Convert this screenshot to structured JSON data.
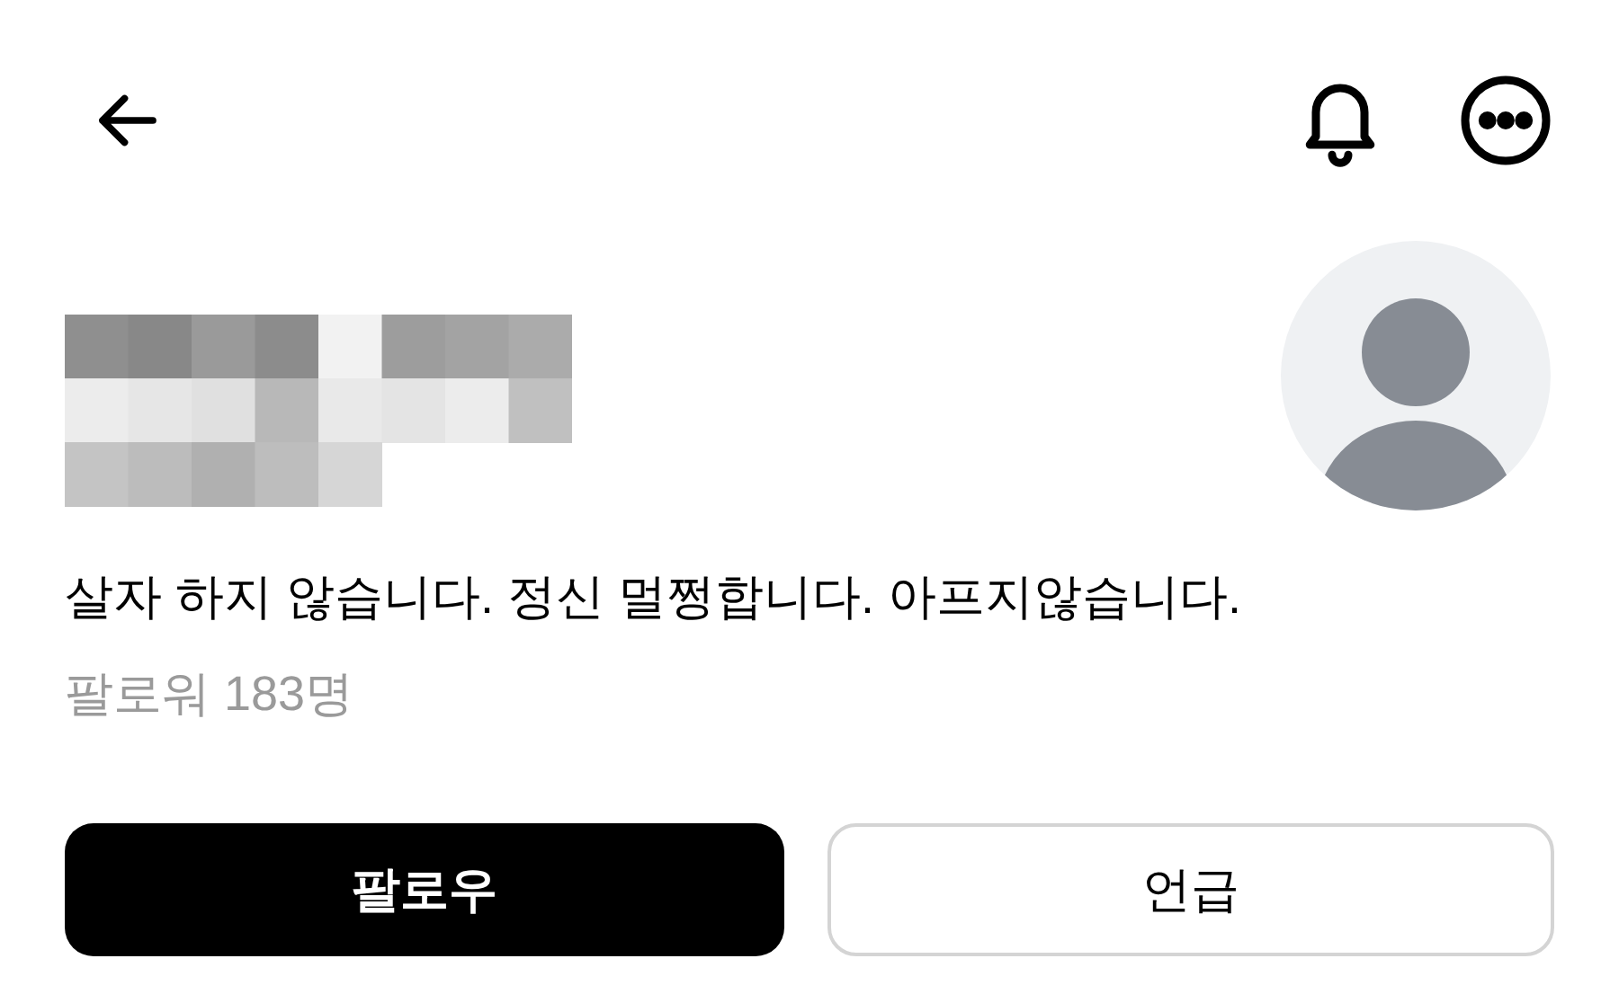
{
  "bio": "살자 하지 않습니다. 정신 멀쩡합니다. 아프지않습니다.",
  "followers": "팔로워 183명",
  "buttons": [
    {
      "label": "팔로우",
      "kind": "primary"
    },
    {
      "label": "언급",
      "kind": "outline"
    }
  ]
}
